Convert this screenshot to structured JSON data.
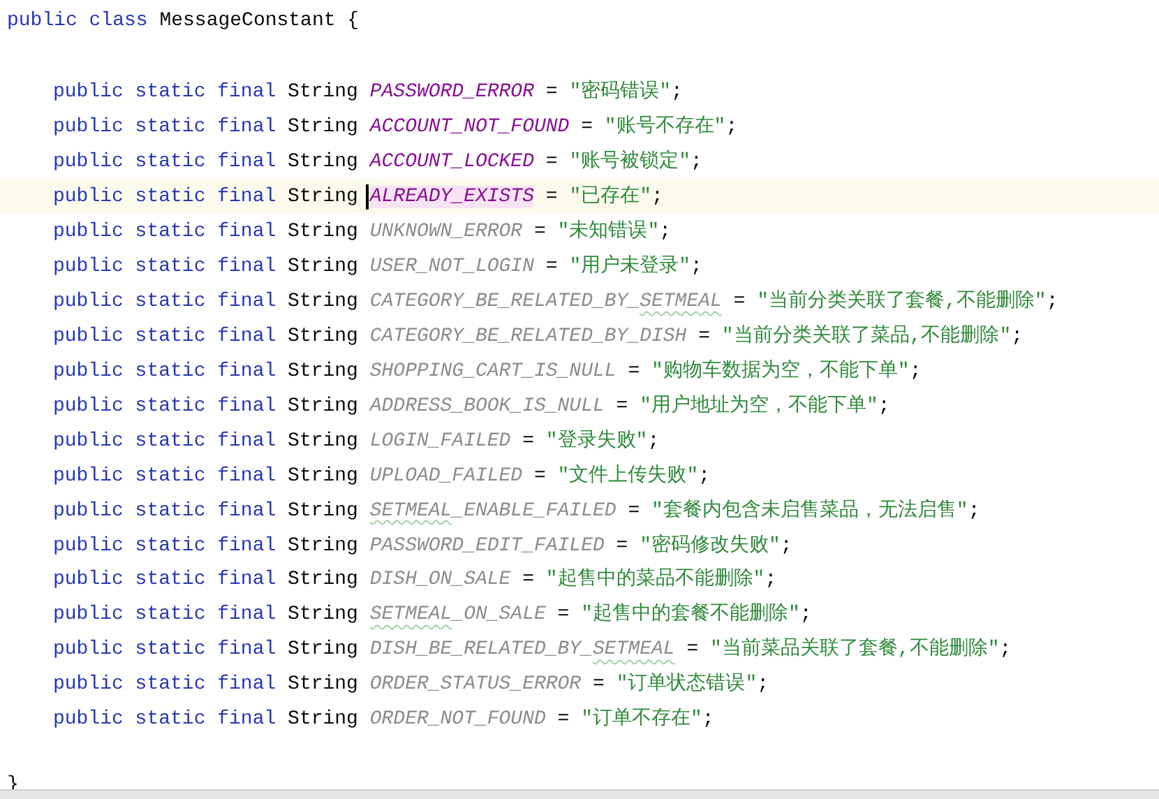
{
  "class_header": {
    "keywords": "public class",
    "name": "MessageConstant",
    "brace": "{"
  },
  "fields": [
    {
      "modifiers": "public static final",
      "type": "String",
      "name_parts": [
        {
          "text": "PASSWORD_ERROR",
          "typo": false
        }
      ],
      "operator": "=",
      "value": "\"密码错误\"",
      "terminator": ";",
      "used": true,
      "current": false
    },
    {
      "modifiers": "public static final",
      "type": "String",
      "name_parts": [
        {
          "text": "ACCOUNT_NOT_FOUND",
          "typo": false
        }
      ],
      "operator": "=",
      "value": "\"账号不存在\"",
      "terminator": ";",
      "used": true,
      "current": false
    },
    {
      "modifiers": "public static final",
      "type": "String",
      "name_parts": [
        {
          "text": "ACCOUNT_LOCKED",
          "typo": false
        }
      ],
      "operator": "=",
      "value": "\"账号被锁定\"",
      "terminator": ";",
      "used": true,
      "current": false
    },
    {
      "modifiers": "public static final",
      "type": "String",
      "name_parts": [
        {
          "text": "ALREADY_EXISTS",
          "typo": false
        }
      ],
      "operator": "=",
      "value": "\"已存在\"",
      "terminator": ";",
      "used": true,
      "current": true
    },
    {
      "modifiers": "public static final",
      "type": "String",
      "name_parts": [
        {
          "text": "UNKNOWN_ERROR",
          "typo": false
        }
      ],
      "operator": "=",
      "value": "\"未知错误\"",
      "terminator": ";",
      "used": false,
      "current": false
    },
    {
      "modifiers": "public static final",
      "type": "String",
      "name_parts": [
        {
          "text": "USER_NOT_LOGIN",
          "typo": false
        }
      ],
      "operator": "=",
      "value": "\"用户未登录\"",
      "terminator": ";",
      "used": false,
      "current": false
    },
    {
      "modifiers": "public static final",
      "type": "String",
      "name_parts": [
        {
          "text": "CATEGORY_BE_RELATED_BY_",
          "typo": false
        },
        {
          "text": "SETMEAL",
          "typo": true
        }
      ],
      "operator": "=",
      "value": "\"当前分类关联了套餐,不能删除\"",
      "terminator": ";",
      "used": false,
      "current": false
    },
    {
      "modifiers": "public static final",
      "type": "String",
      "name_parts": [
        {
          "text": "CATEGORY_BE_RELATED_BY_DISH",
          "typo": false
        }
      ],
      "operator": "=",
      "value": "\"当前分类关联了菜品,不能删除\"",
      "terminator": ";",
      "used": false,
      "current": false
    },
    {
      "modifiers": "public static final",
      "type": "String",
      "name_parts": [
        {
          "text": "SHOPPING_CART_IS_NULL",
          "typo": false
        }
      ],
      "operator": "=",
      "value": "\"购物车数据为空，不能下单\"",
      "terminator": ";",
      "used": false,
      "current": false
    },
    {
      "modifiers": "public static final",
      "type": "String",
      "name_parts": [
        {
          "text": "ADDRESS_BOOK_IS_NULL",
          "typo": false
        }
      ],
      "operator": "=",
      "value": "\"用户地址为空，不能下单\"",
      "terminator": ";",
      "used": false,
      "current": false
    },
    {
      "modifiers": "public static final",
      "type": "String",
      "name_parts": [
        {
          "text": "LOGIN_FAILED",
          "typo": false
        }
      ],
      "operator": "=",
      "value": "\"登录失败\"",
      "terminator": ";",
      "used": false,
      "current": false
    },
    {
      "modifiers": "public static final",
      "type": "String",
      "name_parts": [
        {
          "text": "UPLOAD_FAILED",
          "typo": false
        }
      ],
      "operator": "=",
      "value": "\"文件上传失败\"",
      "terminator": ";",
      "used": false,
      "current": false
    },
    {
      "modifiers": "public static final",
      "type": "String",
      "name_parts": [
        {
          "text": "SETMEAL",
          "typo": true
        },
        {
          "text": "_ENABLE_FAILED",
          "typo": false
        }
      ],
      "operator": "=",
      "value": "\"套餐内包含未启售菜品，无法启售\"",
      "terminator": ";",
      "used": false,
      "current": false
    },
    {
      "modifiers": "public static final",
      "type": "String",
      "name_parts": [
        {
          "text": "PASSWORD_EDIT_FAILED",
          "typo": false
        }
      ],
      "operator": "=",
      "value": "\"密码修改失败\"",
      "terminator": ";",
      "used": false,
      "current": false
    },
    {
      "modifiers": "public static final",
      "type": "String",
      "name_parts": [
        {
          "text": "DISH_ON_SALE",
          "typo": false
        }
      ],
      "operator": "=",
      "value": "\"起售中的菜品不能删除\"",
      "terminator": ";",
      "used": false,
      "current": false
    },
    {
      "modifiers": "public static final",
      "type": "String",
      "name_parts": [
        {
          "text": "SETMEAL",
          "typo": true
        },
        {
          "text": "_ON_SALE",
          "typo": false
        }
      ],
      "operator": "=",
      "value": "\"起售中的套餐不能删除\"",
      "terminator": ";",
      "used": false,
      "current": false
    },
    {
      "modifiers": "public static final",
      "type": "String",
      "name_parts": [
        {
          "text": "DISH_BE_RELATED_BY_",
          "typo": false
        },
        {
          "text": "SETMEAL",
          "typo": true
        }
      ],
      "operator": "=",
      "value": "\"当前菜品关联了套餐,不能删除\"",
      "terminator": ";",
      "used": false,
      "current": false
    },
    {
      "modifiers": "public static final",
      "type": "String",
      "name_parts": [
        {
          "text": "ORDER_STATUS_ERROR",
          "typo": false
        }
      ],
      "operator": "=",
      "value": "\"订单状态错误\"",
      "terminator": ";",
      "used": false,
      "current": false
    },
    {
      "modifiers": "public static final",
      "type": "String",
      "name_parts": [
        {
          "text": "ORDER_NOT_FOUND",
          "typo": false
        }
      ],
      "operator": "=",
      "value": "\"订单不存在\"",
      "terminator": ";",
      "used": false,
      "current": false
    }
  ],
  "closing": {
    "brace": "}"
  }
}
